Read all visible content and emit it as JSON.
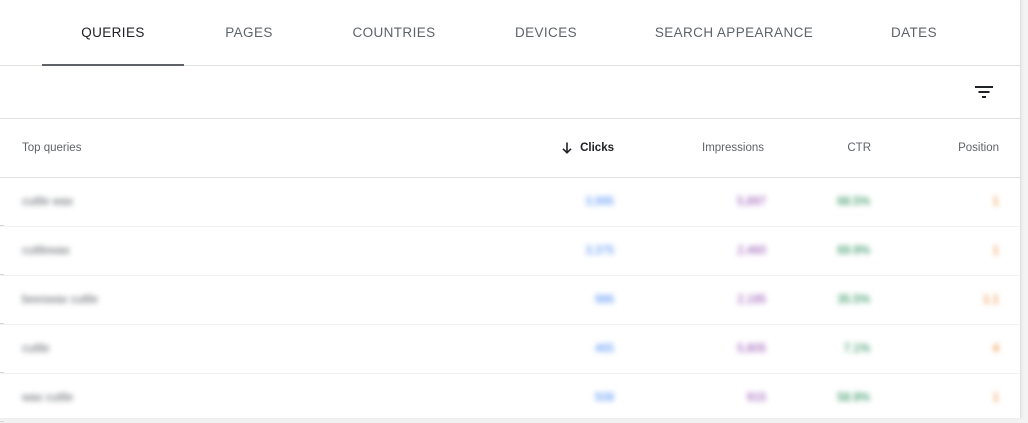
{
  "tabs": [
    {
      "label": "QUERIES",
      "active": true
    },
    {
      "label": "PAGES",
      "active": false
    },
    {
      "label": "COUNTRIES",
      "active": false
    },
    {
      "label": "DEVICES",
      "active": false
    },
    {
      "label": "SEARCH APPEARANCE",
      "active": false
    },
    {
      "label": "DATES",
      "active": false
    }
  ],
  "toolbar": {
    "filter_icon": "filter-list-icon"
  },
  "table": {
    "columns": {
      "query": "Top queries",
      "clicks": "Clicks",
      "impressions": "Impressions",
      "ctr": "CTR",
      "position": "Position"
    },
    "sort": {
      "column": "clicks",
      "direction": "descending",
      "icon": "arrow-down-icon"
    },
    "rows": [
      {
        "query": "cuttle wax",
        "clicks": "3,995",
        "impressions": "5,897",
        "ctr": "68.5%",
        "position": "1"
      },
      {
        "query": "cuttlewax",
        "clicks": "3,375",
        "impressions": "2,460",
        "ctr": "69.9%",
        "position": "1"
      },
      {
        "query": "beeswax cuttle",
        "clicks": "986",
        "impressions": "2,185",
        "ctr": "35.5%",
        "position": "1.1"
      },
      {
        "query": "cuttle",
        "clicks": "465",
        "impressions": "5,805",
        "ctr": "7.1%",
        "position": "4"
      },
      {
        "query": "wax cuttle",
        "clicks": "508",
        "impressions": "915",
        "ctr": "58.9%",
        "position": "1"
      }
    ]
  },
  "colors": {
    "clicks": "#4285f4",
    "impressions": "#8e44ad",
    "ctr": "#0b8043",
    "position": "#e8710a"
  }
}
